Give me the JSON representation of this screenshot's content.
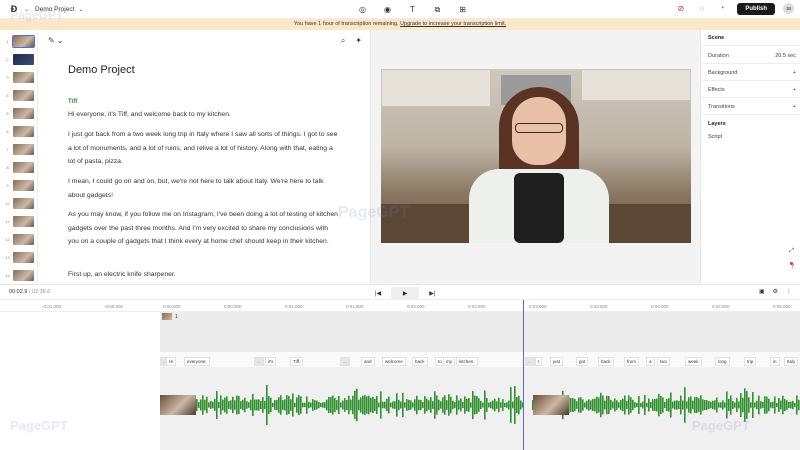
{
  "topbar": {
    "logo": "Ð",
    "project_name": "Demo Project",
    "publish_label": "Publish",
    "avatar_initials": "JB"
  },
  "banner": {
    "text": "You have 1 hour of transcription remaining.",
    "link": "Upgrade to increase your transcription limit."
  },
  "rail": {
    "thumbs": [
      "1",
      "2",
      "3",
      "4",
      "5",
      "6",
      "7",
      "8",
      "9",
      "10",
      "11",
      "12",
      "13",
      "14"
    ]
  },
  "script": {
    "title": "Demo Project",
    "speaker": "Tiff",
    "paragraphs": [
      "Hi everyone, it's Tiff, and welcome back to my kitchen.",
      "I just got back from a two week long trip in Italy where I saw all sorts of things. I got to see a lot of monuments, and a lot of ruins, and relive a lot of history. Along with that, eating a lot of pasta, pizza.",
      "I mean, I could go on and on, but, we're not here to talk about Italy. We're here to talk about gadgets!",
      "As you may know, if you follow me on Instagram, I've been doing a lot of testing of kitchen gadgets over the past three months. And I'm very excited to share my conclusions with you on a couple of gadgets that I think every at home chef should keep in their kitchen.",
      "First up, an electric knife sharpener."
    ]
  },
  "inspector": {
    "scene_label": "Scene",
    "duration_label": "Duration",
    "duration_value": "20.5 sec",
    "background_label": "Background",
    "effects_label": "Effects",
    "transitions_label": "Transitions",
    "layers_label": "Layers",
    "layer_script": "Script"
  },
  "transport": {
    "current": "00:02.9",
    "separator": "/",
    "total": "02:38.6"
  },
  "ruler_ticks": [
    "-0:01.000",
    "-0:00.500",
    "0:00.000",
    "0:00.500",
    "0:01.000",
    "0:01.500",
    "0:02.000",
    "0:02.500",
    "0:03.000",
    "0:03.500",
    "0:04.000",
    "0:04.500",
    "0:05.000"
  ],
  "timeline": {
    "scene_number": "1",
    "words_a": [
      "Hi",
      "everyone,",
      "...",
      "it's",
      "Tiff,",
      "...",
      "and",
      "welcome",
      "back",
      "to",
      "my",
      "kitchen."
    ],
    "words_b": [
      "I",
      "just",
      "got",
      "back",
      "from",
      "a",
      "two",
      "week",
      "long",
      "trip",
      "in",
      "Italy"
    ]
  },
  "watermark": "PageGPT",
  "colors": {
    "accent": "#5c6bc0",
    "speaker": "#2b8a3e",
    "waveform": "#2f8f2f",
    "banner": "#fbe7c8"
  }
}
